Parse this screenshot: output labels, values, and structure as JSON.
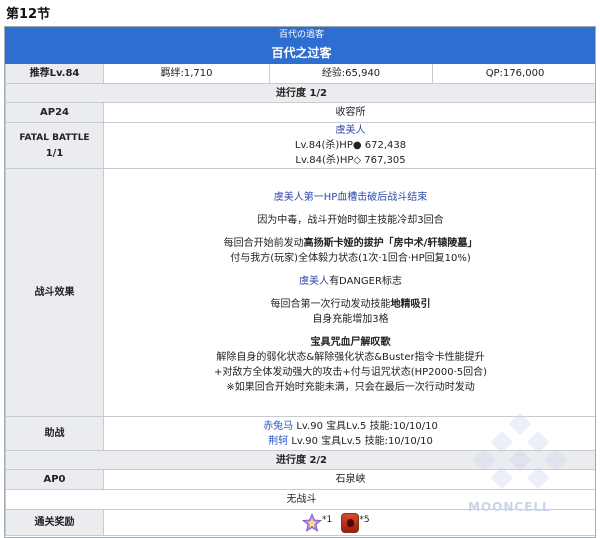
{
  "section_title": "第12节",
  "quest": {
    "name_jp": "百代の過客",
    "name_cn": "百代之过客"
  },
  "info": {
    "recommend": "推荐Lv.84",
    "bond": "羁绊:1,710",
    "exp": "经验:65,940",
    "qp": "QP:176,000"
  },
  "progress1": {
    "label": "进行度 1/2",
    "ap_label": "AP24",
    "location": "收容所",
    "fatal_label": "FATAL BATTLE",
    "fatal_count": "1/1",
    "enemy_name": "虞美人",
    "enemy_hp1": "Lv.84(杀)HP● 672,438",
    "enemy_hp2": "Lv.84(杀)HP◇ 767,305"
  },
  "effects": {
    "label": "战斗效果",
    "l1_name": "虞美人",
    "l1_rest": "第一HP血槽击破后战斗结束",
    "l2": "因为中毒，战斗开始时御主技能冷却3回合",
    "l3_pre": "每回合开始前发动",
    "l3_bold": "高扬斯卡娅的拔护「房中术/轩辕陵墓」",
    "l4": "付与我方(玩家)全体毅力状态(1次·1回合·HP回复10%)",
    "l5_name": "虞美人",
    "l5_rest": "有DANGER标志",
    "l6_pre": "每回合第一次行动发动技能",
    "l6_bold": "地精吸引",
    "l7": "自身充能增加3格",
    "l8": "宝具咒血尸解叹歌",
    "l9": "解除自身的弱化状态&解除强化状态&Buster指令卡性能提升",
    "l10": "+对敌方全体发动强大的攻击+付与诅咒状态(HP2000·5回合)",
    "l11": "※如果回合开始时充能未满，只会在最后一次行动时发动"
  },
  "support": {
    "label": "助战",
    "s1_name": "赤兔马",
    "s1_rest": "Lv.90 宝具Lv.5 技能:10/10/10",
    "s2_name": "荆轲",
    "s2_rest": "Lv.90 宝具Lv.5 技能:10/10/10"
  },
  "progress2": {
    "label": "进行度 2/2",
    "ap_label": "AP0",
    "location": "石泉峡",
    "no_battle": "无战斗"
  },
  "reward": {
    "label": "通关奖励",
    "item1_count": "*1",
    "item2_count": "*5"
  },
  "watermark": "MOONCELL",
  "colors": {
    "header_blue": "#2d6ed0",
    "label_gray": "#eaecf0",
    "enemy_blue": "#3b4ba8"
  }
}
